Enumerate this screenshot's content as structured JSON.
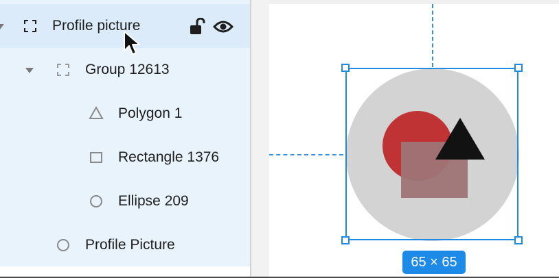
{
  "layers": [
    {
      "label": "Profile picture",
      "icon": "frame-icon",
      "selected": true
    },
    {
      "label": "Group 12613",
      "icon": "group-frame-icon"
    },
    {
      "label": "Polygon 1",
      "icon": "triangle-icon"
    },
    {
      "label": "Rectangle 1376",
      "icon": "rectangle-icon"
    },
    {
      "label": "Ellipse 209",
      "icon": "circle-icon"
    },
    {
      "label": "Profile Picture",
      "icon": "circle-icon"
    }
  ],
  "canvas": {
    "size_label": "65 × 65"
  },
  "colors": {
    "selection": "#1e8ae8",
    "ellipse": "#c03334",
    "rectangle": "#9e7476",
    "triangle": "#121212",
    "background_circle": "#d3d3d3"
  }
}
